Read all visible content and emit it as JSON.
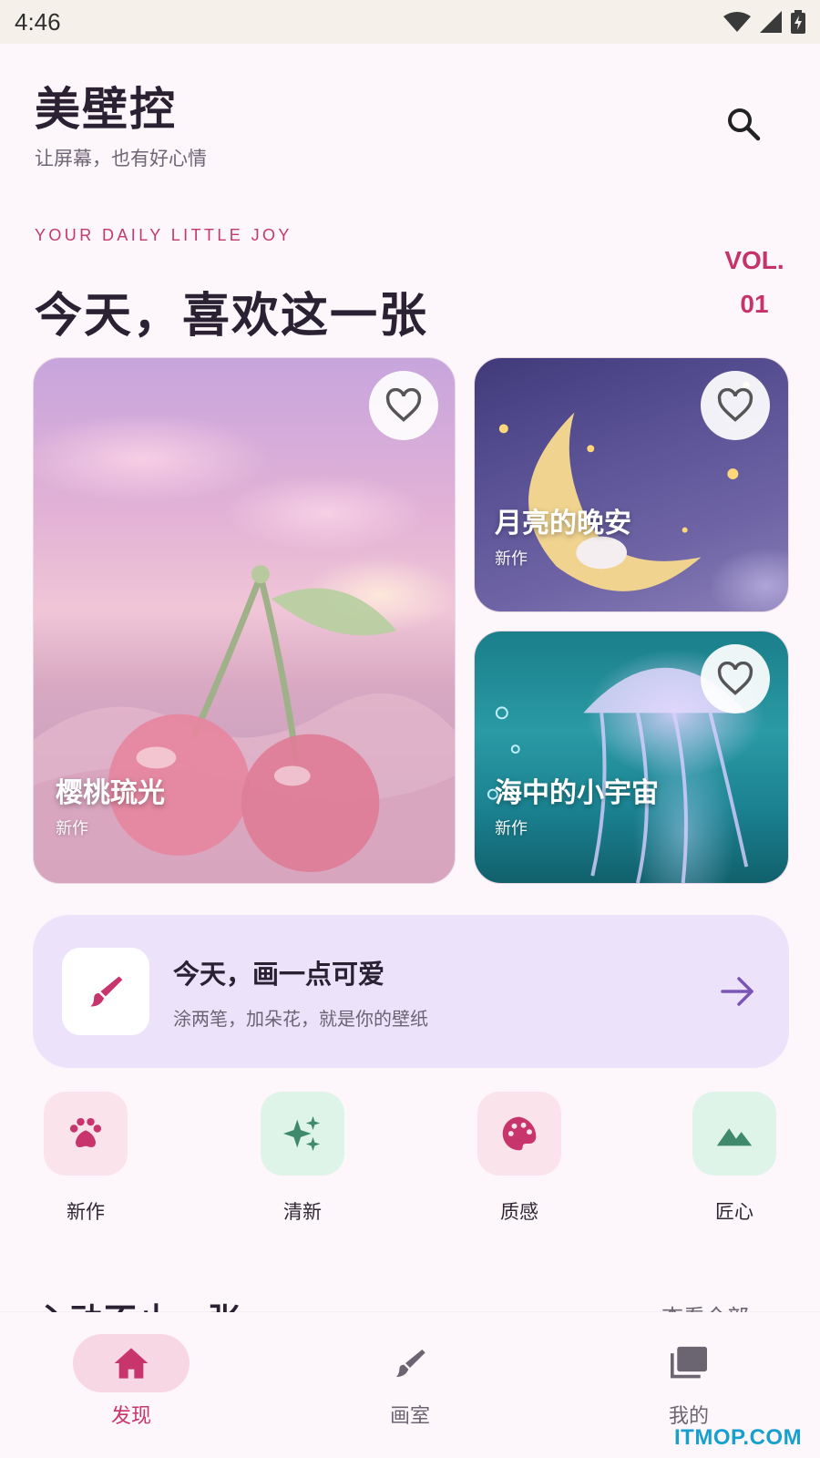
{
  "status_bar": {
    "time": "4:46"
  },
  "header": {
    "app_title": "美壁控",
    "subtitle": "让屏幕，也有好心情"
  },
  "featured": {
    "kicker": "YOUR DAILY LITTLE JOY",
    "title": "今天，喜欢这一张",
    "vol_label": "VOL.",
    "vol_number": "01",
    "cards": [
      {
        "title": "樱桃琉光",
        "tag": "新作"
      },
      {
        "title": "月亮的晚安",
        "tag": "新作"
      },
      {
        "title": "海中的小宇宙",
        "tag": "新作"
      }
    ]
  },
  "draw_banner": {
    "title": "今天，画一点可爱",
    "subtitle": "涂两笔，加朵花，就是你的壁纸"
  },
  "categories": [
    {
      "label": "新作",
      "icon": "paw-icon",
      "bg": "#fbe3ec",
      "fg": "#c8356c"
    },
    {
      "label": "清新",
      "icon": "sparkle-icon",
      "bg": "#dff4e8",
      "fg": "#3f8a6c"
    },
    {
      "label": "质感",
      "icon": "palette-icon",
      "bg": "#fbe3ec",
      "fg": "#c8356c"
    },
    {
      "label": "匠心",
      "icon": "landscape-icon",
      "bg": "#dff4e8",
      "fg": "#3f8a6c"
    }
  ],
  "next_section": {
    "title": "心动不止一张",
    "link": "查看全部"
  },
  "bottom_nav": [
    {
      "label": "发现",
      "icon": "home-icon",
      "active": true
    },
    {
      "label": "画室",
      "icon": "brush-icon",
      "active": false
    },
    {
      "label": "我的",
      "icon": "collection-icon",
      "active": false
    }
  ],
  "colors": {
    "accent": "#c8356c",
    "banner_bg": "#ece3fb",
    "arrow": "#7b55b5"
  },
  "watermark": "ITMOP.COM"
}
